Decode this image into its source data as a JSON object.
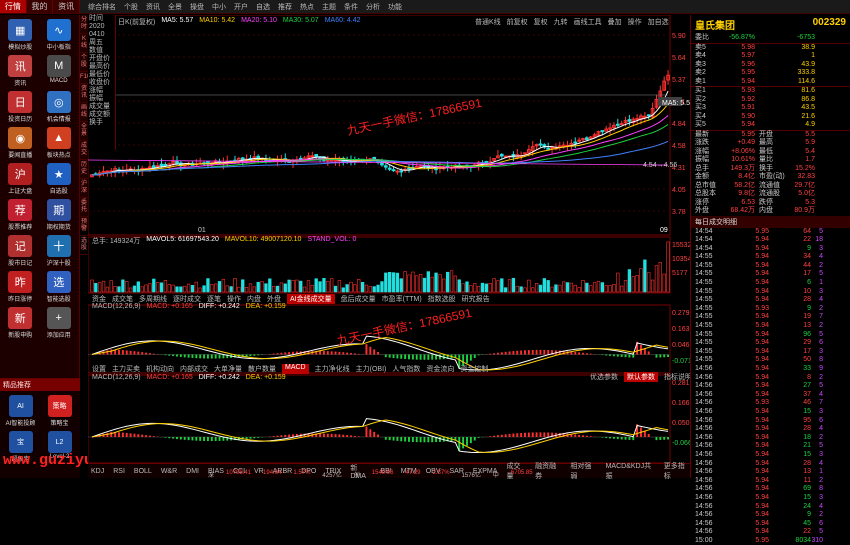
{
  "menu": {
    "tabs": [
      "行情",
      "我的",
      "资讯"
    ],
    "buttons": [
      "综合排名",
      "个股",
      "资讯",
      "全景",
      "操盘",
      "中小",
      "开户",
      "自选",
      "推荐",
      "热点",
      "主题",
      "条件",
      "分析",
      "功能"
    ]
  },
  "left_apps": [
    {
      "label": "模拟炒股",
      "icon": "chart-icon",
      "color": "#3060b0",
      "glyph": "▦"
    },
    {
      "label": "中小板指",
      "icon": "line-chart-icon",
      "color": "#2070d0",
      "glyph": "∿"
    },
    {
      "label": "资讯",
      "icon": "news-icon",
      "color": "#c04040",
      "glyph": "讯"
    },
    {
      "label": "MACD",
      "icon": "macd-icon",
      "color": "#4a4a4a",
      "glyph": "M"
    },
    {
      "label": "投资日历",
      "icon": "calendar-icon",
      "color": "#c03030",
      "glyph": "日"
    },
    {
      "label": "机会情报",
      "icon": "radar-icon",
      "color": "#3070c0",
      "glyph": "◎"
    },
    {
      "label": "要闻直播",
      "icon": "broadcast-icon",
      "color": "#c06020",
      "glyph": "◉"
    },
    {
      "label": "板块热点",
      "icon": "fire-icon",
      "color": "#d04020",
      "glyph": "▲"
    },
    {
      "label": "上证大盘",
      "icon": "index-icon",
      "color": "#b02020",
      "glyph": "沪"
    },
    {
      "label": "自选股",
      "icon": "star-icon",
      "color": "#2060c0",
      "glyph": "★"
    },
    {
      "label": "股票推荐",
      "icon": "recommend-icon",
      "color": "#c02030",
      "glyph": "荐"
    },
    {
      "label": "期权期货",
      "icon": "option-icon",
      "color": "#3050a0",
      "glyph": "期"
    },
    {
      "label": "股市日记",
      "icon": "diary-icon",
      "color": "#b03030",
      "glyph": "记"
    },
    {
      "label": "沪深十股",
      "icon": "group-icon",
      "color": "#2070b0",
      "glyph": "十"
    },
    {
      "label": "昨日涨停",
      "icon": "limit-up-icon",
      "color": "#c02020",
      "glyph": "昨"
    },
    {
      "label": "智能选股",
      "icon": "select-icon",
      "color": "#3060c0",
      "glyph": "选"
    },
    {
      "label": "新股申购",
      "icon": "ipo-icon",
      "color": "#c03030",
      "glyph": "新"
    },
    {
      "label": "添加应用",
      "icon": "add-icon",
      "color": "#555555",
      "glyph": "+"
    }
  ],
  "left_footer": {
    "header": "精品推荐",
    "items": [
      {
        "label": "AI智能投顾",
        "glyph": "AI"
      },
      {
        "label": "策略宝",
        "glyph": "策略"
      },
      {
        "label": "超级宝",
        "glyph": "宝"
      },
      {
        "label": "Level-2",
        "glyph": "L2"
      }
    ]
  },
  "vertical_tabs": [
    "分时",
    "K线",
    "个股",
    "F10",
    "资讯",
    "画线",
    "全景",
    "成交",
    "历史",
    "沪深",
    "委托",
    "预警",
    "选股"
  ],
  "info_panel": [
    "时间",
    "2020",
    "0410",
    "周五",
    "数值",
    "开盘价",
    "最高价",
    "最低价",
    "收盘价",
    "涨幅",
    "振幅",
    "成交量",
    "成交额",
    "换手"
  ],
  "kline": {
    "legend": [
      {
        "text": "日K(前复权)",
        "color": "#bbbbbb"
      },
      {
        "text": "MA5: 5.57",
        "color": "#ffffff"
      },
      {
        "text": "MA10: 5.42",
        "color": "#ffd000"
      },
      {
        "text": "MA20: 5.10",
        "color": "#ff40ff"
      },
      {
        "text": "MA30: 5.07",
        "color": "#20d040"
      },
      {
        "text": "MA60: 4.42",
        "color": "#4080ff"
      }
    ],
    "tools": [
      "普通K线",
      "前复权",
      "复权",
      "九转",
      "画线工具",
      "叠加",
      "操作",
      "加自选"
    ],
    "yaxis": [
      "5.90",
      "5.64",
      "5.37",
      "5.11",
      "4.84",
      "4.58",
      "4.31",
      "4.05",
      "3.78"
    ],
    "price_label": "MA5: 5.57",
    "low_label": "4.54→4.56",
    "date_tag": "09"
  },
  "volume": {
    "legend": [
      {
        "text": "总手: 149324万",
        "color": "#bbbbbb"
      },
      {
        "text": "MAVOL5: 61697543.20",
        "color": "#ffffff"
      },
      {
        "text": "MAVOL10: 49007120.10",
        "color": "#ffd000"
      },
      {
        "text": "STAND_VOL: 0",
        "color": "#ff40ff"
      }
    ],
    "yaxis": [
      "15532",
      "10354",
      "5177"
    ]
  },
  "macd_tabs1": [
    "资金",
    "成交笔",
    "多周期线",
    "逐时成交",
    "逐笔",
    "操作",
    "内盘",
    "外盘",
    "AI金线成交量",
    "盘后成交量",
    "市盈率(TTM)",
    "指数选股",
    "研究报告"
  ],
  "macd_legend1": [
    {
      "text": "MACD(12,26,9)",
      "color": "#bbbbbb"
    },
    {
      "text": "MACD: +0.165",
      "color": "#ff4040"
    },
    {
      "text": "DIFF: +0.242",
      "color": "#ffffff"
    },
    {
      "text": "DEA: +0.159",
      "color": "#ffd000"
    }
  ],
  "macd_yaxis1": [
    "0.279",
    "0.163",
    "0.046",
    "-0.071"
  ],
  "macd_tabs2": [
    "设置",
    "主力买卖",
    "机构动向",
    "内部成交",
    "大单净量",
    "散户数量",
    "MACD",
    "主力净化线",
    "主力(OBI)",
    "人气指数",
    "资金流向",
    "资金控制"
  ],
  "macd_buttons2": [
    "优选参数",
    "默认参数",
    "指标说明"
  ],
  "macd_legend2": [
    {
      "text": "MACD(12,26,9)",
      "color": "#bbbbbb"
    },
    {
      "text": "MACD: +0.165",
      "color": "#ff4040"
    },
    {
      "text": "DIFF: +0.242",
      "color": "#ffffff"
    },
    {
      "text": "DEA: +0.159",
      "color": "#ffd000"
    }
  ],
  "macd_yaxis2": [
    "0.281",
    "0.166",
    "0.050",
    "-0.066"
  ],
  "bottom_indicators": [
    "KDJ",
    "RSI",
    "BOLL",
    "W&R",
    "DMI",
    "BIAS",
    "CCI",
    "VR",
    "ARBR",
    "DPO",
    "TRIX",
    "新DMA",
    "BBI",
    "MTM",
    "OBV",
    "SAR",
    "EXPMA",
    "成交量",
    "融资融券",
    "相对强弱",
    "MACD&KDJ共振",
    "更多指标"
  ],
  "status_bar": [
    {
      "text": "深",
      "color": "#bbbbbb"
    },
    {
      "text": "10798.41",
      "color": "#ff4040"
    },
    {
      "text": "194.64",
      "color": "#ff4040"
    },
    {
      "text": "1.57%",
      "color": "#ff4040"
    },
    {
      "text": "4257亿",
      "color": "#bbbbbb"
    },
    {
      "text": "创",
      "color": "#bbbbbb"
    },
    {
      "text": "1549.96",
      "color": "#ff4040"
    },
    {
      "text": "47.29",
      "color": "#ff4040"
    },
    {
      "text": "2.37%",
      "color": "#ff4040"
    },
    {
      "text": "1576亿",
      "color": "#bbbbbb"
    },
    {
      "text": "中",
      "color": "#bbbbbb"
    },
    {
      "text": "6705.85",
      "color": "#ff4040"
    }
  ],
  "stock": {
    "name": "皇氏集团",
    "code": "002329",
    "weibi_label": "委比",
    "weibi_pct": "-56.87%",
    "weibi_val": "-6753",
    "sells": [
      {
        "label": "卖5",
        "price": "5.98",
        "vol": "38.9"
      },
      {
        "label": "卖4",
        "price": "5.97",
        "vol": "1"
      },
      {
        "label": "卖3",
        "price": "5.96",
        "vol": "43.9"
      },
      {
        "label": "卖2",
        "price": "5.95",
        "vol": "333.8"
      },
      {
        "label": "卖1",
        "price": "5.94",
        "vol": "114.6"
      }
    ],
    "buys": [
      {
        "label": "买1",
        "price": "5.93",
        "vol": "81.6"
      },
      {
        "label": "买2",
        "price": "5.92",
        "vol": "86.8"
      },
      {
        "label": "买3",
        "price": "5.91",
        "vol": "43.5"
      },
      {
        "label": "买4",
        "price": "5.90",
        "vol": "21.6"
      },
      {
        "label": "买5",
        "price": "5.94",
        "vol": "4.9"
      }
    ],
    "stats": [
      [
        "最新",
        "5.95",
        "开盘",
        "5.5"
      ],
      [
        "涨跌",
        "+0.49",
        "最高",
        "5.9"
      ],
      [
        "涨幅",
        "+8.06%",
        "最低",
        "5.4"
      ],
      [
        "振幅",
        "10.61%",
        "量比",
        "1.7"
      ],
      [
        "总手",
        "149.3万",
        "换手",
        "15.2%"
      ],
      [
        "金额",
        "8.4亿",
        "市盈(动)",
        "32.83"
      ],
      [
        "总市值",
        "58.2亿",
        "流通值",
        "29.7亿"
      ],
      [
        "总股本",
        "9.8亿",
        "流通股",
        "5.0亿"
      ],
      [
        "涨停",
        "6.53",
        "跌停",
        "5.3"
      ],
      [
        "外盘",
        "68.42万",
        "内盘",
        "80.9万"
      ]
    ],
    "tick_header": "每日成交明细",
    "ticks": [
      [
        "14:54",
        "5.95",
        "64",
        "5"
      ],
      [
        "14:54",
        "5.94",
        "22",
        "18"
      ],
      [
        "14:54",
        "5.94",
        "9",
        "3"
      ],
      [
        "14:55",
        "5.94",
        "34",
        "4"
      ],
      [
        "14:55",
        "5.94",
        "44",
        "2"
      ],
      [
        "14:55",
        "5.94",
        "17",
        "5"
      ],
      [
        "14:55",
        "5.94",
        "6",
        "1"
      ],
      [
        "14:55",
        "5.94",
        "10",
        "3"
      ],
      [
        "14:55",
        "5.94",
        "28",
        "4"
      ],
      [
        "14:55",
        "5.93",
        "9",
        "2"
      ],
      [
        "14:55",
        "5.94",
        "19",
        "7"
      ],
      [
        "14:55",
        "5.94",
        "13",
        "2"
      ],
      [
        "14:55",
        "5.94",
        "96",
        "5"
      ],
      [
        "14:55",
        "5.94",
        "29",
        "6"
      ],
      [
        "14:55",
        "5.94",
        "17",
        "3"
      ],
      [
        "14:55",
        "5.94",
        "50",
        "8"
      ],
      [
        "14:56",
        "5.94",
        "33",
        "9"
      ],
      [
        "14:56",
        "5.94",
        "8",
        "2"
      ],
      [
        "14:56",
        "5.94",
        "27",
        "5"
      ],
      [
        "14:56",
        "5.94",
        "37",
        "4"
      ],
      [
        "14:56",
        "5.93",
        "46",
        "7"
      ],
      [
        "14:56",
        "5.94",
        "15",
        "3"
      ],
      [
        "14:56",
        "5.94",
        "95",
        "6"
      ],
      [
        "14:56",
        "5.94",
        "28",
        "4"
      ],
      [
        "14:56",
        "5.94",
        "18",
        "2"
      ],
      [
        "14:56",
        "5.94",
        "21",
        "5"
      ],
      [
        "14:56",
        "5.94",
        "15",
        "3"
      ],
      [
        "14:56",
        "5.94",
        "28",
        "4"
      ],
      [
        "14:56",
        "5.94",
        "13",
        "1"
      ],
      [
        "14:56",
        "5.94",
        "11",
        "2"
      ],
      [
        "14:56",
        "5.94",
        "69",
        "8"
      ],
      [
        "14:56",
        "5.94",
        "15",
        "3"
      ],
      [
        "14:56",
        "5.94",
        "24",
        "4"
      ],
      [
        "14:56",
        "5.94",
        "9",
        "2"
      ],
      [
        "14:56",
        "5.94",
        "45",
        "6"
      ],
      [
        "14:56",
        "5.94",
        "22",
        "5"
      ],
      [
        "15:00",
        "5.95",
        "8034",
        "310"
      ]
    ]
  },
  "watermark": "www.guziyuan.cn",
  "overlay_text": "九天一手微信：17866591"
}
